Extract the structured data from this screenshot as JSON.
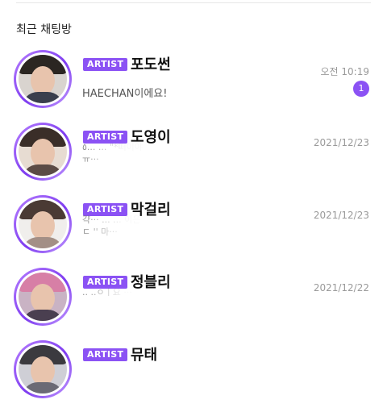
{
  "section": {
    "title": "최근 채팅방"
  },
  "chats": [
    {
      "badge": "ARTIST",
      "name": "포도썬",
      "time": "오전 10:19",
      "preview": "HAECHAN이에요!",
      "unread": "1",
      "avatar": {
        "hair": "#2b2622",
        "shoulder": "#3a3f4d"
      }
    },
    {
      "badge": "ARTIST",
      "name": "도영이",
      "time": "2021/12/23",
      "preview_lines": [
        "٥...   ...            \"*떠이야",
        "                                           ㅠ···"
      ],
      "avatar": {
        "hair": "#3a2e28",
        "shoulder": "#5b4b45"
      }
    },
    {
      "badge": "ARTIST",
      "name": "막걸리",
      "time": "2021/12/23",
      "preview_lines": [
        "갹···  ...             ...      이은",
        "ㄷ                                       '' 마···"
      ],
      "avatar": {
        "hair": "#4a3a34",
        "shoulder": "#a38f86"
      }
    },
    {
      "badge": "ARTIST",
      "name": "정블리",
      "time": "2021/12/22",
      "preview_lines": [
        "",
        "                           .. ..ㅇㅣ요  ···"
      ],
      "avatar": {
        "hair": "#d77fa6",
        "shoulder": "#4a3f50"
      }
    },
    {
      "badge": "ARTIST",
      "name": "뮤태",
      "avatar": {
        "hair": "#3b3a3f",
        "shoulder": "#6b6a75"
      }
    }
  ]
}
